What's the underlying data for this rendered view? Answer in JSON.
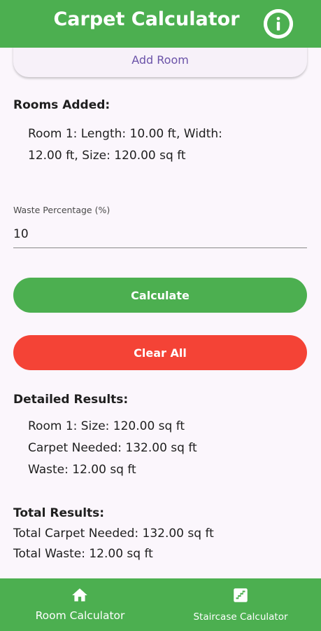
{
  "app_bar": {
    "title": "Carpet Calculator",
    "info_icon": "info-icon",
    "color": "#4caf50"
  },
  "add_room": {
    "label": "Add Room"
  },
  "rooms_added": {
    "heading": "Rooms Added:",
    "items": [
      "Room 1: Length: 10.00 ft, Width: 12.00 ft, Size: 120.00 sq ft"
    ]
  },
  "waste": {
    "label": "Waste Percentage (%)",
    "value": "10"
  },
  "buttons": {
    "calculate": "Calculate",
    "clear_all": "Clear All",
    "calculate_color": "#4caf50",
    "clear_color": "#f44336"
  },
  "detailed_results": {
    "heading": "Detailed Results:",
    "lines": [
      "Room 1: Size: 120.00 sq ft",
      "Carpet Needed: 132.00 sq ft",
      "Waste: 12.00 sq ft"
    ]
  },
  "total_results": {
    "heading": "Total Results:",
    "lines": [
      "Total Carpet Needed: 132.00 sq ft",
      "Total Waste: 12.00 sq ft"
    ]
  },
  "bottom_nav": {
    "items": [
      {
        "label": "Room Calculator",
        "icon": "home-icon"
      },
      {
        "label": "Staircase Calculator",
        "icon": "staircase-icon"
      }
    ]
  }
}
